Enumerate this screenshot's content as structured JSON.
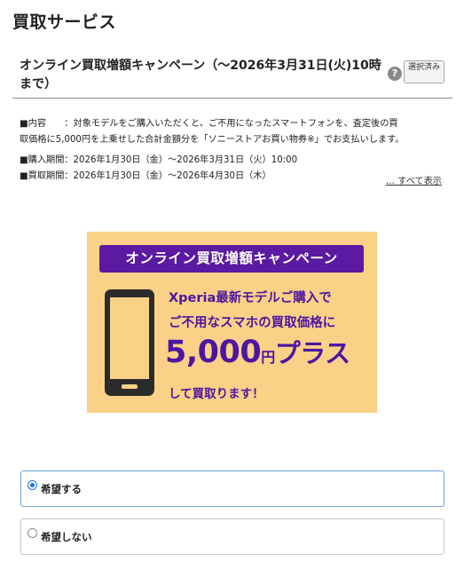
{
  "page": {
    "title": "買取サービス"
  },
  "campaign": {
    "title": "オンライン買取増額キャンペーン（〜2026年3月31日(火)10時まで）",
    "help_icon": "?",
    "selected_label": "選択済み",
    "details": {
      "content_line1": "■内容　　：対象モデルをご購入いただくと、ご不用になったスマートフォンを、査定後の買",
      "content_line2": "取価格に5,000円を上乗せした合計金額分を「ソニーストアお買い物券※」でお支払いします。",
      "purchase_period": "■購入期間：2026年1月30日（金）〜2026年3月31日（火）10:00",
      "buyback_period": "■買取期間：2026年1月30日（金）〜2026年4月30日（木）"
    },
    "show_all_link": "… すべて表示"
  },
  "banner": {
    "heading": "オンライン買取増額キャンペーン",
    "line1": "Xperia最新モデルご購入で",
    "line2": "ご不用なスマホの買取価格に",
    "amount": "5,000",
    "unit": "円",
    "plus": "プラス",
    "line3": "して買取ります！",
    "colors": {
      "background": "#fbd187",
      "accent": "#5b1aa1"
    }
  },
  "options": [
    {
      "label": "希望する",
      "checked": true
    },
    {
      "label": "希望しない",
      "checked": false
    }
  ]
}
